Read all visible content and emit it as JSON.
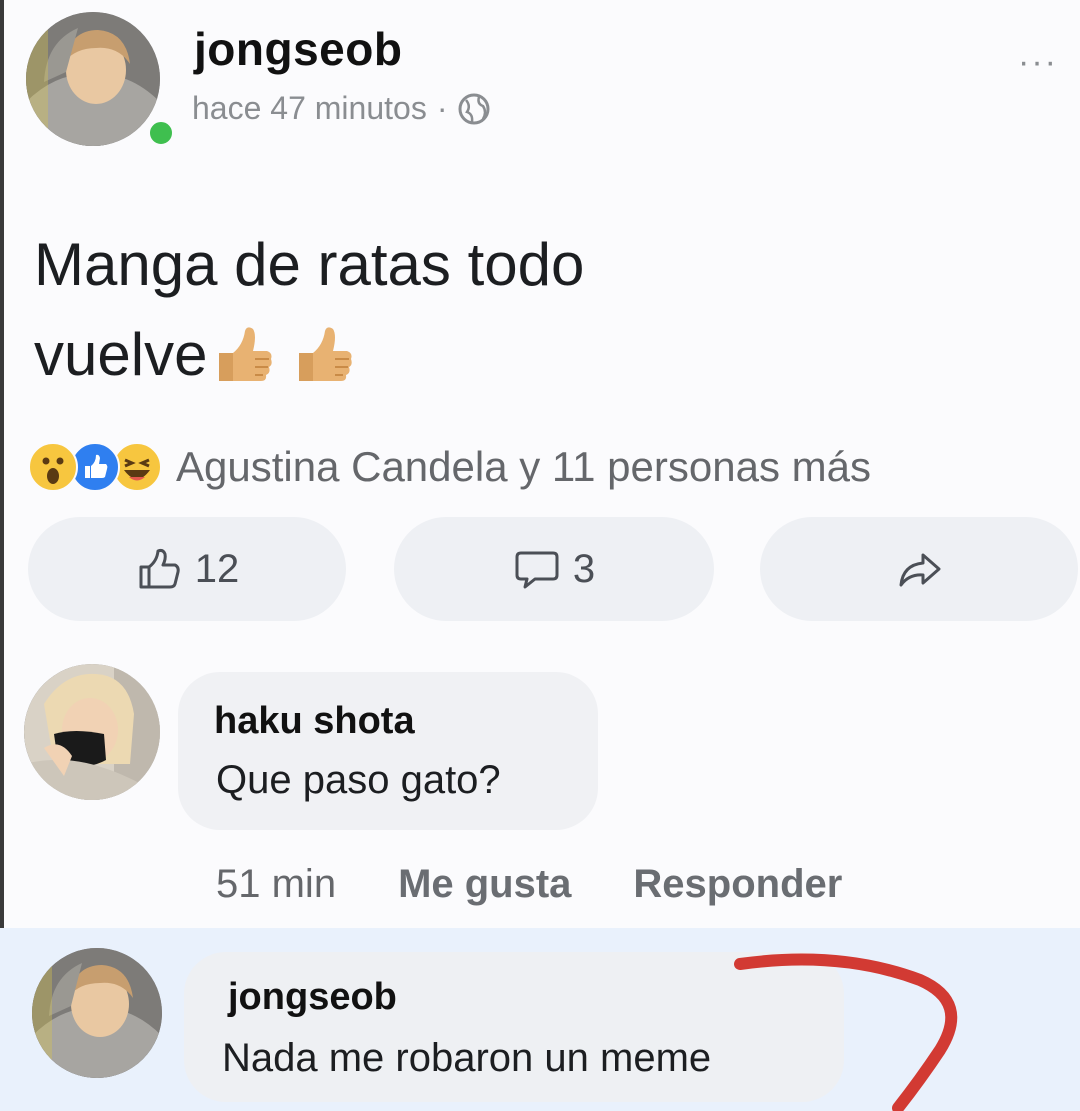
{
  "post": {
    "author": "jongseob",
    "time": "hace 47 minutos",
    "separator": "·",
    "more": "···",
    "text": "Manga de ratas todo vuelve",
    "text_line1": "Manga de ratas todo",
    "text_line2": "vuelve",
    "reactions_text": "Agustina Candela y 11 personas más",
    "like_count": "12",
    "comment_count": "3"
  },
  "comment": {
    "author": "haku shota",
    "text": "Que paso gato?",
    "time": "51 min",
    "like_label": "Me gusta",
    "reply_label": "Responder"
  },
  "reply": {
    "author": "jongseob",
    "text": "Nada me robaron un meme"
  },
  "colors": {
    "online": "#3fbf4f",
    "highlight": "#e9f1fc",
    "annotation": "#d23a33"
  },
  "icons": [
    "globe-icon",
    "more-icon",
    "thumbs-up-emoji",
    "wow-reaction-icon",
    "like-reaction-icon",
    "haha-reaction-icon",
    "like-outline-icon",
    "comment-icon",
    "share-icon"
  ]
}
